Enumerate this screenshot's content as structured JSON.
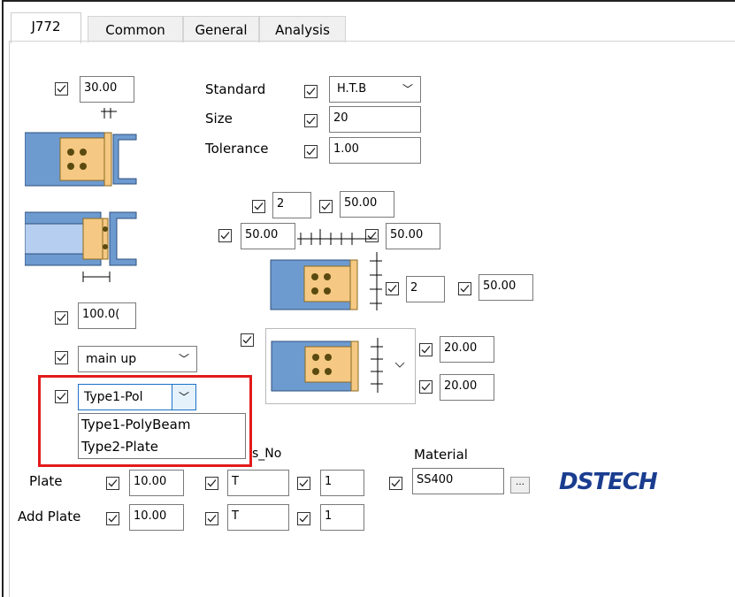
{
  "tabs": [
    {
      "label": "J772"
    },
    {
      "label": "Common"
    },
    {
      "label": "General"
    },
    {
      "label": "Analysis"
    }
  ],
  "top_gap_value": "30.00",
  "standard": {
    "label": "Standard",
    "value": "H.T.B"
  },
  "size": {
    "label": "Size",
    "value": "20"
  },
  "tolerance": {
    "label": "Tolerance",
    "value": "1.00"
  },
  "bolt_row": {
    "count": "2",
    "pitch": "50.00"
  },
  "edge_left": "50.00",
  "edge_right": "50.00",
  "bolt_col": {
    "count": "2",
    "pitch": "50.00"
  },
  "length_value": "100.0(",
  "position_combo": "main up",
  "type_combo": "Type1-Pol",
  "type_options": [
    "Type1-PolyBeam",
    "Type2-Plate"
  ],
  "stiff_top": "20.00",
  "stiff_bottom": "20.00",
  "headers": {
    "no": "s_No",
    "material": "Material"
  },
  "plate": {
    "label": "Plate",
    "thick": "10.00",
    "grade": "T",
    "no": "1",
    "material": "SS400"
  },
  "add_plate": {
    "label": "Add Plate",
    "thick": "10.00",
    "grade": "T",
    "no": "1"
  },
  "logo": "DSTECH",
  "colors": {
    "beam": "#6d9bd0",
    "plate": "#f5c983",
    "bolt": "#5a4a10",
    "highlight": "#e21b1b"
  }
}
